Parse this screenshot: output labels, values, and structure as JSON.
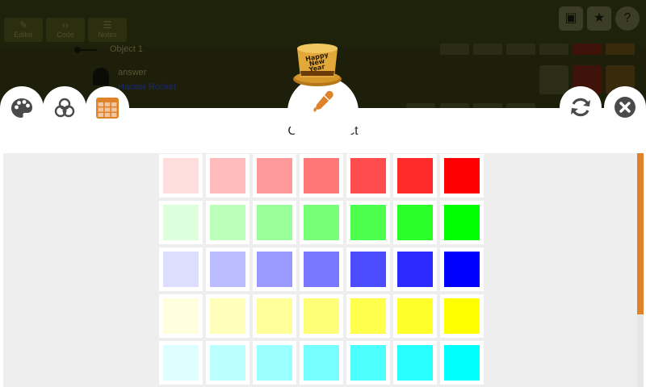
{
  "background_editor": {
    "tabs": [
      {
        "label": "Editor",
        "glyph": "✎"
      },
      {
        "label": "Code",
        "glyph": "‹›"
      },
      {
        "label": "Notes",
        "glyph": "☰"
      }
    ],
    "row_label": "Object 1",
    "sub_label": "answer",
    "link_label": "Hacker Rocket"
  },
  "tabs": {
    "palette_icon": "palette-icon",
    "mixer_icon": "color-mixer-icon",
    "swatches_icon": "swatch-grid-icon"
  },
  "accent_color": "#e0822a",
  "dialog": {
    "title": "Color Select",
    "eyedropper_icon": "eyedropper-icon",
    "hat_text": [
      "Happy",
      "New",
      "Year"
    ],
    "refresh_icon": "refresh-icon",
    "close_icon": "close-icon"
  },
  "swatches": [
    [
      "#ffdddd",
      "#ffbbbb",
      "#ff9999",
      "#ff7777",
      "#ff4c4c",
      "#ff2a2a",
      "#ff0000"
    ],
    [
      "#ddffdd",
      "#bbffbb",
      "#99ff99",
      "#77ff77",
      "#4cff4c",
      "#2aff2a",
      "#00ff00"
    ],
    [
      "#ddddff",
      "#bbbbff",
      "#9999ff",
      "#7777ff",
      "#4c4cff",
      "#2a2aff",
      "#0000ff"
    ],
    [
      "#ffffdd",
      "#ffffbb",
      "#ffff99",
      "#ffff77",
      "#ffff4c",
      "#ffff2a",
      "#ffff00"
    ],
    [
      "#ddffff",
      "#bbffff",
      "#99ffff",
      "#77ffff",
      "#4cffff",
      "#2affff",
      "#00ffff"
    ]
  ]
}
